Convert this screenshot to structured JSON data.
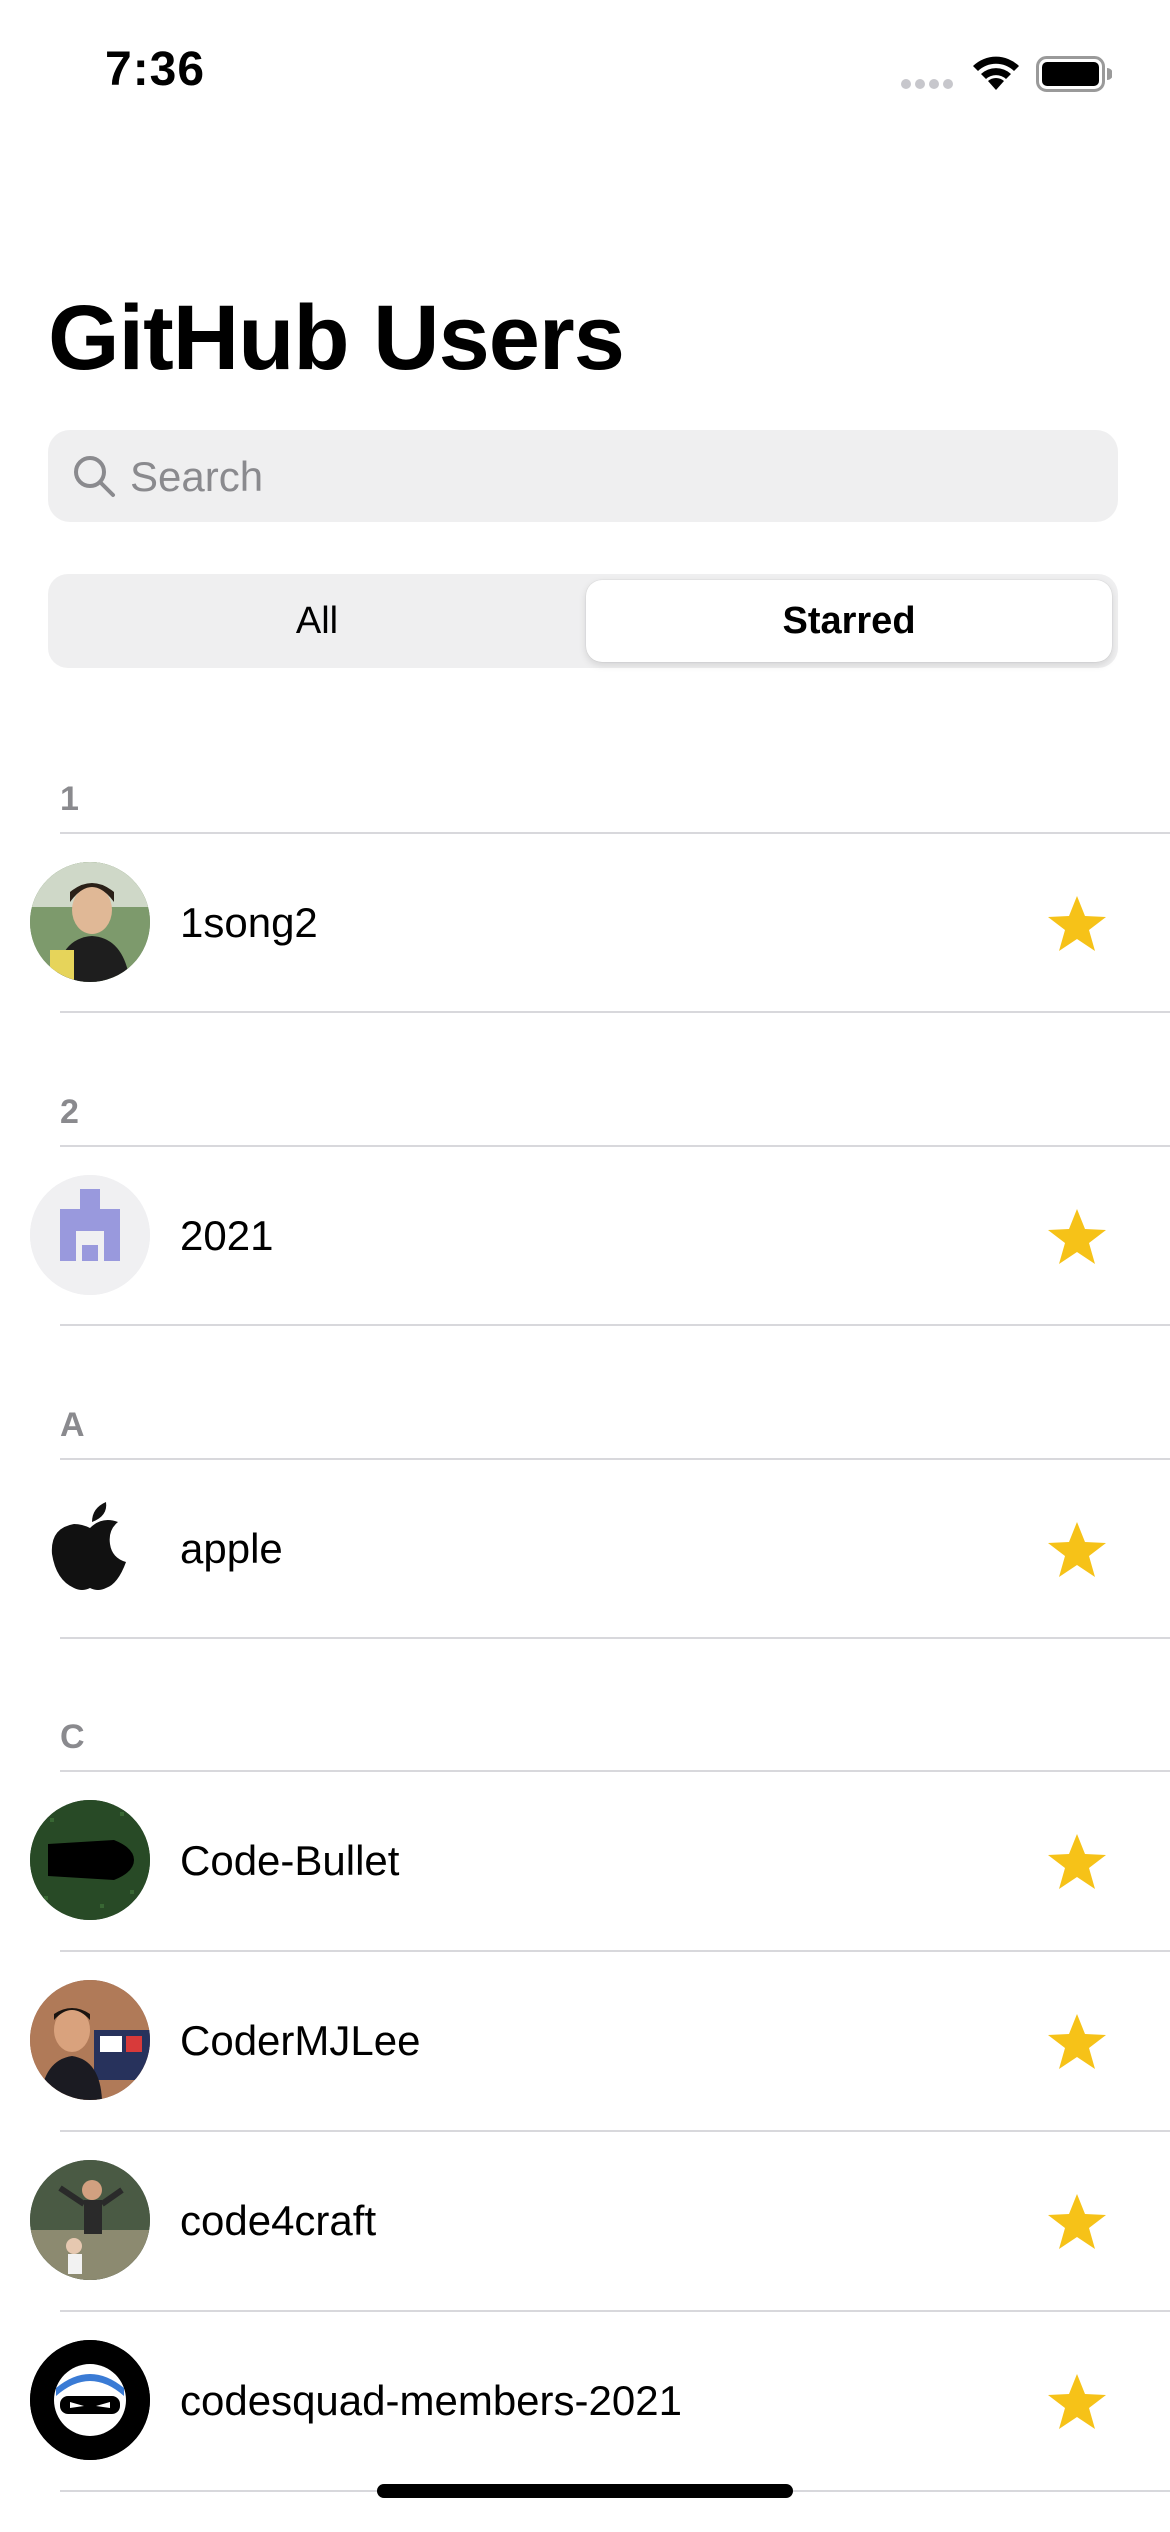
{
  "status_bar": {
    "time": "7:36"
  },
  "header": {
    "title": "GitHub Users"
  },
  "search": {
    "placeholder": "Search",
    "value": ""
  },
  "segmented": {
    "options": [
      "All",
      "Starred"
    ],
    "selected": "Starred"
  },
  "sections": [
    {
      "header": "1",
      "users": [
        {
          "login": "1song2",
          "starred": true,
          "avatar": "photo-avatar"
        }
      ]
    },
    {
      "header": "2",
      "users": [
        {
          "login": "2021",
          "starred": true,
          "avatar": "identicon-avatar"
        }
      ]
    },
    {
      "header": "A",
      "users": [
        {
          "login": "apple",
          "starred": true,
          "avatar": "apple-logo"
        }
      ]
    },
    {
      "header": "C",
      "users": [
        {
          "login": "Code-Bullet",
          "starred": true,
          "avatar": "bullet-avatar"
        },
        {
          "login": "CoderMJLee",
          "starred": true,
          "avatar": "photo-avatar"
        },
        {
          "login": "code4craft",
          "starred": true,
          "avatar": "photo-avatar"
        },
        {
          "login": "codesquad-members-2021",
          "starred": true,
          "avatar": "ninja-avatar"
        }
      ]
    }
  ],
  "colors": {
    "star": "#f6c218",
    "search_bg": "#efeff0",
    "section_header": "#8a8a8e",
    "identicon": "#9999dd"
  }
}
